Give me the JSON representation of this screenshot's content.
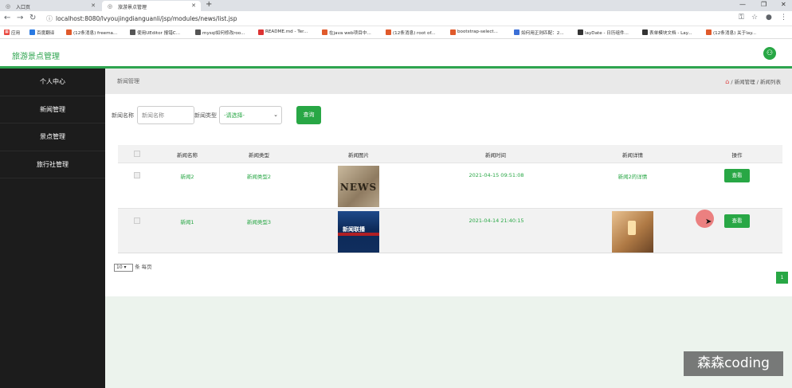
{
  "browser": {
    "tabs": [
      {
        "title": "入口页"
      },
      {
        "title": "旅游景点管理"
      }
    ],
    "url": "localhost:8080/lvyoujingdianguanli/jsp/modules/news/list.jsp",
    "bookmarks": [
      {
        "label": "应用",
        "color": "#e8453c"
      },
      {
        "label": "百度翻译",
        "color": "#2a7ae2"
      },
      {
        "label": "(12条消息) freema...",
        "color": "#e05a2b"
      },
      {
        "label": "使用UEditor 报错C...",
        "color": "#555555"
      },
      {
        "label": "mysql如何修改roo...",
        "color": "#555555"
      },
      {
        "label": "README.md - Ter...",
        "color": "#d33"
      },
      {
        "label": "在java web项目中...",
        "color": "#e05a2b"
      },
      {
        "label": "(12条消息) root of...",
        "color": "#e05a2b"
      },
      {
        "label": "bootstrap-select...",
        "color": "#e05a2b"
      },
      {
        "label": "如何用正则匹配：2...",
        "color": "#3b6fd6"
      },
      {
        "label": "layDate - 日历组件...",
        "color": "#333333"
      },
      {
        "label": "表单模块文档 - Lay...",
        "color": "#333333"
      },
      {
        "label": "(12条消息) 关于lay...",
        "color": "#e05a2b"
      }
    ]
  },
  "app": {
    "title": "旅游景点管理"
  },
  "sidebar": {
    "items": [
      {
        "label": "个人中心"
      },
      {
        "label": "新闻管理"
      },
      {
        "label": "景点管理"
      },
      {
        "label": "旅行社管理"
      }
    ]
  },
  "page": {
    "title": "新闻管理",
    "breadcrumb": [
      "新闻管理",
      "新闻列表"
    ],
    "breadcrumb_sep": "/"
  },
  "filters": {
    "name_label": "新闻名称",
    "name_placeholder": "新闻名称",
    "type_label": "新闻类型",
    "type_selected": "-请选择-",
    "query_button": "查询"
  },
  "table": {
    "columns": [
      "新闻名称",
      "新闻类型",
      "新闻图片",
      "新闻时间",
      "新闻详情",
      "操作"
    ],
    "rows": [
      {
        "name": "新闻2",
        "type": "新闻类型2",
        "image_text": "NEWS",
        "time": "2021-04-15 09:51:08",
        "detail": "新闻2的详情",
        "action": "查看"
      },
      {
        "name": "新闻1",
        "type": "新闻类型3",
        "image_text": "新闻联播",
        "time": "2021-04-14 21:40:15",
        "detail": "",
        "action": "查看"
      }
    ]
  },
  "pagination": {
    "page_size": "10",
    "page_size_suffix": "条 每页",
    "current_page": "1"
  },
  "watermark": "森森coding",
  "colors": {
    "accent": "#28a745",
    "sidebar": "#1c1c1c",
    "main_bg": "#ecf3ed"
  }
}
